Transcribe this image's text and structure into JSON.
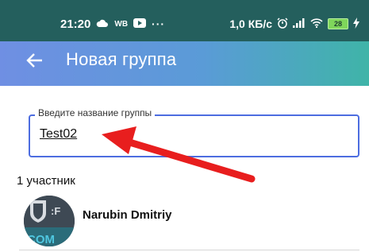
{
  "status_bar": {
    "time": "21:20",
    "carrier": "WB",
    "more": "···",
    "network_speed": "1,0 КБ/с",
    "battery": "28"
  },
  "app_bar": {
    "title": "Новая группа"
  },
  "group_name_field": {
    "label": "Введите название группы",
    "value": "Test02"
  },
  "participants": {
    "count_label": "1 участник",
    "items": [
      {
        "name": "Narubin Dmitriy",
        "avatar_text": "COM"
      }
    ]
  },
  "colors": {
    "status_bar": "#245f5d",
    "app_bar_start": "#6f8fe3",
    "app_bar_end": "#3fb4a8",
    "field_border": "#4d6de0",
    "arrow": "#e81e1e"
  },
  "icons": [
    "cloud-icon",
    "youtube-icon",
    "alarm-icon",
    "signal-icon",
    "wifi-icon",
    "battery-icon",
    "charging-icon",
    "back-arrow-icon"
  ]
}
